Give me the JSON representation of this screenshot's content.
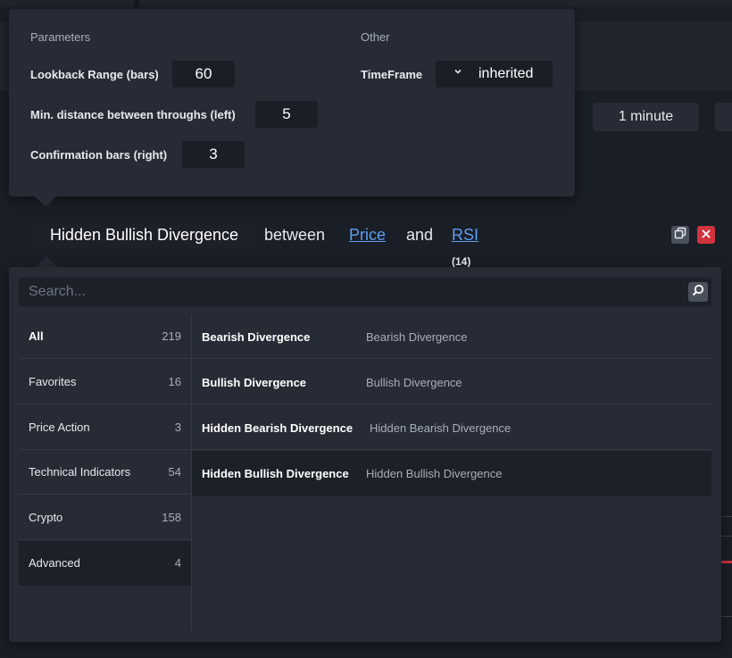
{
  "params": {
    "section_title": "Parameters",
    "other_title": "Other",
    "lookback_label": "Lookback Range (bars)",
    "lookback_value": "60",
    "min_distance_label": "Min. distance between throughs (left)",
    "min_distance_value": "5",
    "confirmation_label": "Confirmation bars (right)",
    "confirmation_value": "3",
    "timeframe_label": "TimeFrame",
    "timeframe_value": "inherited"
  },
  "background": {
    "timeframe_button": "1 minute"
  },
  "condition": {
    "indicator": "Hidden Bullish Divergence",
    "between": "between",
    "source1": "Price",
    "and": "and",
    "source2": "RSI",
    "source2_param": "(14)"
  },
  "picker": {
    "search_placeholder": "Search...",
    "categories": [
      {
        "label": "All",
        "count": "219"
      },
      {
        "label": "Favorites",
        "count": "16"
      },
      {
        "label": "Price Action",
        "count": "3"
      },
      {
        "label": "Technical Indicators",
        "count": "54"
      },
      {
        "label": "Crypto",
        "count": "158"
      },
      {
        "label": "Advanced",
        "count": "4"
      }
    ],
    "items": [
      {
        "name": "Bearish Divergence",
        "desc": "Bearish Divergence"
      },
      {
        "name": "Bullish Divergence",
        "desc": "Bullish Divergence"
      },
      {
        "name": "Hidden Bearish Divergence",
        "desc": "Hidden Bearish Divergence"
      },
      {
        "name": "Hidden Bullish Divergence",
        "desc": "Hidden Bullish Divergence"
      }
    ]
  },
  "colors": {
    "background": "#1a1e26",
    "panel": "#262b35",
    "input": "#1c2029",
    "link": "#5e9ef0",
    "close": "#d0343f"
  },
  "icons": {
    "search": "magnifier-icon",
    "copy": "copy-icon",
    "close": "close-icon",
    "dropdown": "chevron-down-icon"
  }
}
